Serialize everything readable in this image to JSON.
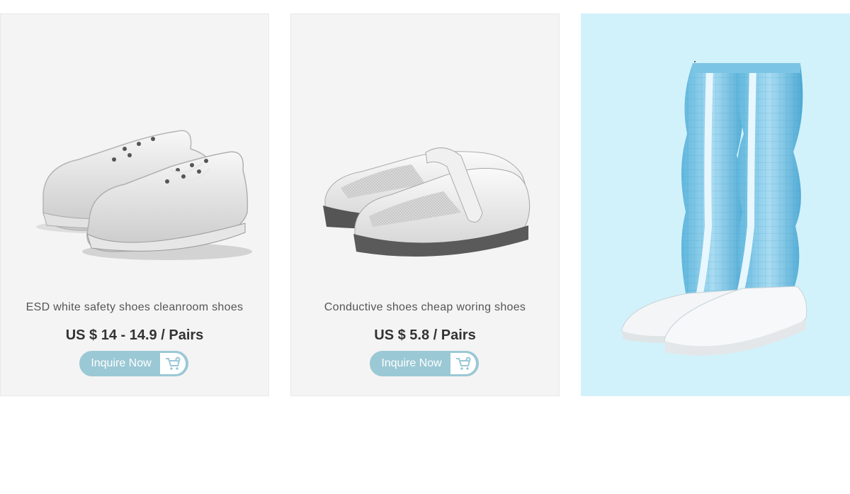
{
  "products": [
    {
      "title": "ESD white safety shoes cleanroom shoes",
      "price": "US $  14 - 14.9 / Pairs",
      "button_label": "Inquire Now",
      "button_icon": "cart-icon"
    },
    {
      "title": "Conductive shoes cheap woring shoes",
      "price": "US $ 5.8 / Pairs",
      "button_label": "Inquire Now",
      "button_icon": "cart-icon"
    },
    {
      "image": "blue-cleanroom-boots"
    }
  ],
  "colors": {
    "card_bg": "#f4f4f4",
    "highlight_bg": "#d2f2fb",
    "button": "#9bc8d5",
    "price_text": "#333333",
    "title_text": "#555555"
  }
}
